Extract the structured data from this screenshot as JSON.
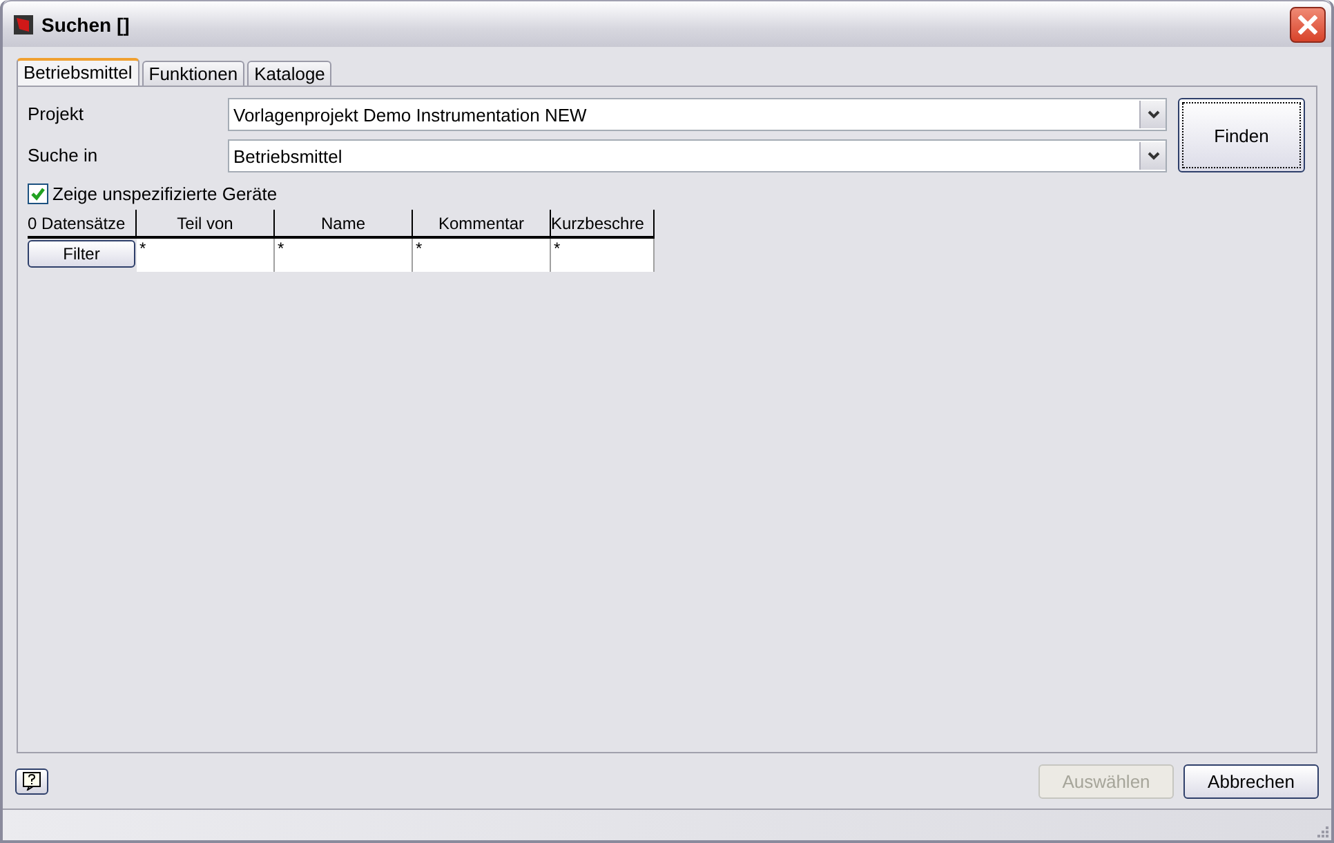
{
  "window": {
    "title": "Suchen  []"
  },
  "tabs": [
    {
      "label": "Betriebsmittel",
      "selected": true
    },
    {
      "label": "Funktionen",
      "selected": false
    },
    {
      "label": "Kataloge",
      "selected": false
    }
  ],
  "fields": [
    {
      "label": "Projekt",
      "value": "Vorlagenprojekt Demo Instrumentation NEW"
    },
    {
      "label": "Suche in",
      "value": "Betriebsmittel"
    }
  ],
  "find_button": "Finden",
  "show_unspecified": {
    "label": "Zeige unspezifizierte Geräte",
    "checked": true
  },
  "table": {
    "record_count": "0 Datensätze",
    "columns": [
      "Teil von",
      "Name",
      "Kommentar",
      "Kurzbeschre"
    ],
    "filter_button": "Filter",
    "filter_values": [
      "*",
      "*",
      "*",
      "*"
    ]
  },
  "buttons": [
    {
      "label": "Auswählen",
      "disabled": true
    },
    {
      "label": "Abbrechen",
      "disabled": false
    }
  ]
}
